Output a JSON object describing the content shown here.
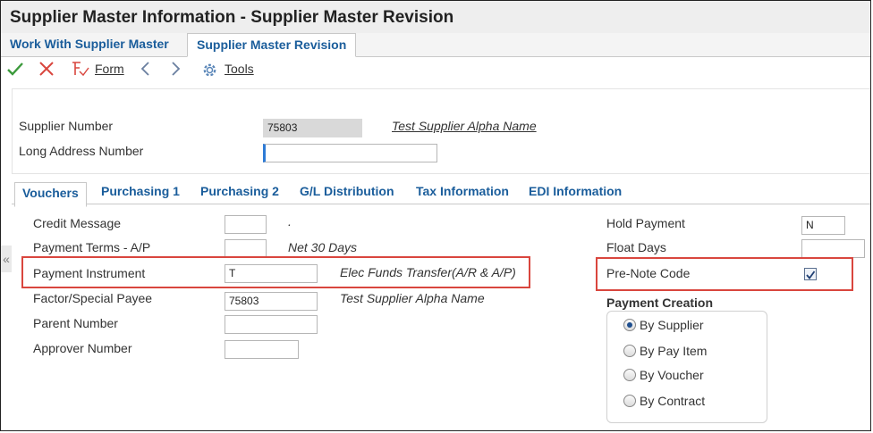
{
  "window": {
    "title": "Supplier Master Information - Supplier Master Revision"
  },
  "top_tabs": [
    "Work With Supplier Master",
    "Supplier Master Revision"
  ],
  "toolbar": {
    "form_label": "Form",
    "tools_label": "Tools"
  },
  "header": {
    "supplier_number_label": "Supplier Number",
    "supplier_number_value": "75803",
    "supplier_name": "Test Supplier Alpha Name",
    "long_address_label": "Long Address Number",
    "long_address_value": ""
  },
  "tabs": [
    "Vouchers",
    "Purchasing 1",
    "Purchasing 2",
    "G/L Distribution",
    "Tax Information",
    "EDI Information"
  ],
  "vouchers": {
    "credit_message_label": "Credit Message",
    "credit_message_value": "",
    "credit_message_desc": ".",
    "payment_terms_label": "Payment Terms - A/P",
    "payment_terms_value": "",
    "payment_terms_desc": "Net 30 Days",
    "payment_instrument_label": "Payment Instrument",
    "payment_instrument_value": "T",
    "payment_instrument_desc": "Elec Funds Transfer(A/R & A/P)",
    "factor_payee_label": "Factor/Special Payee",
    "factor_payee_value": "75803",
    "factor_payee_desc": "Test Supplier Alpha Name",
    "parent_number_label": "Parent Number",
    "parent_number_value": "",
    "approver_number_label": "Approver Number",
    "approver_number_value": "",
    "hold_payment_label": "Hold Payment",
    "hold_payment_value": "N",
    "float_days_label": "Float Days",
    "float_days_value": "",
    "prenote_label": "Pre-Note Code",
    "prenote_checked": true,
    "payment_creation_title": "Payment Creation",
    "payment_creation_options": [
      "By Supplier",
      "By Pay Item",
      "By Voucher",
      "By Contract"
    ],
    "payment_creation_selected": "By Supplier"
  },
  "colors": {
    "link_blue": "#1a5d9b",
    "highlight_red": "#d9463e",
    "ok_green": "#3c9a3c",
    "cancel_red": "#d9463e"
  }
}
